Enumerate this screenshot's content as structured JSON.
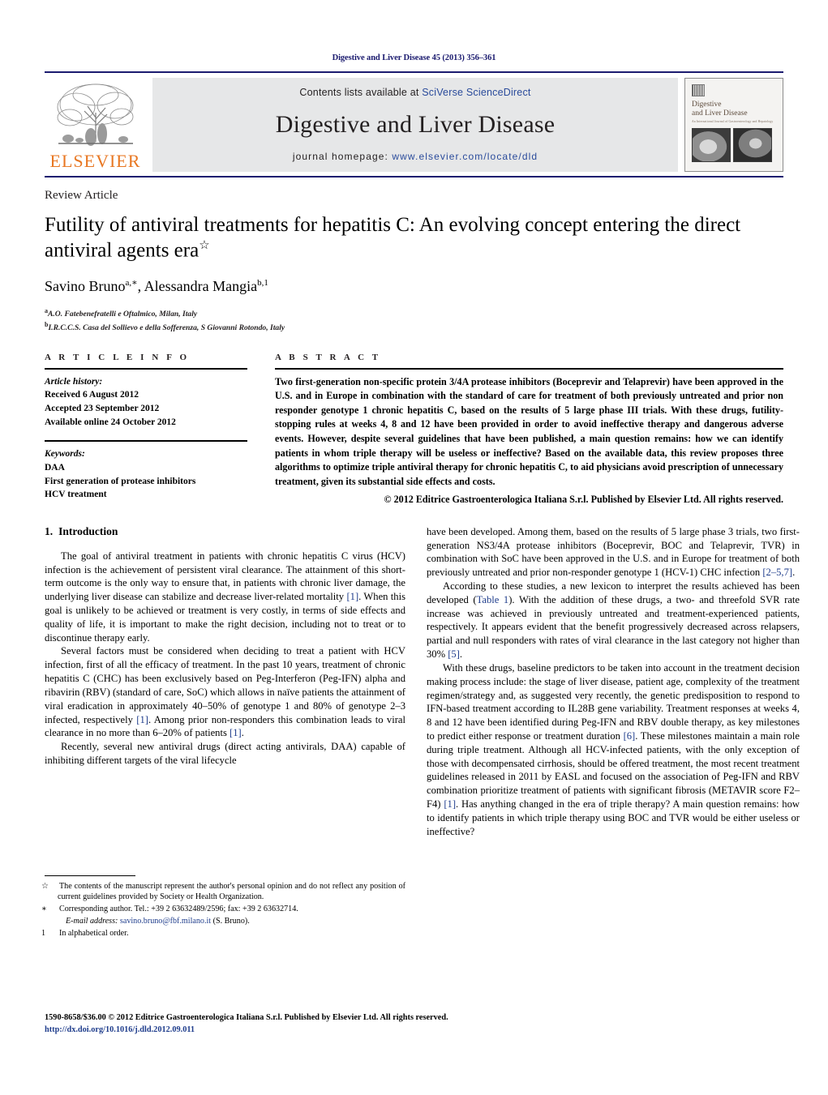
{
  "running_head": "Digestive and Liver Disease 45 (2013) 356–361",
  "masthead": {
    "publisher_name": "ELSEVIER",
    "contents_prefix": "Contents lists available at ",
    "contents_link": "SciVerse ScienceDirect",
    "journal_title": "Digestive and Liver Disease",
    "homepage_label": "journal homepage: ",
    "homepage_url": "www.elsevier.com/locate/dld",
    "cover": {
      "title_line1": "Digestive",
      "title_line2": "and Liver Disease",
      "subtitle": "An International Journal of Gastroenterology and Hepatology"
    }
  },
  "article": {
    "type": "Review Article",
    "title": "Futility of antiviral treatments for hepatitis C: An evolving concept entering the direct antiviral agents era",
    "title_marker": "☆",
    "authors_html": "Savino Bruno<sup>a,∗</sup>, Alessandra Mangia<sup>b,1</sup>",
    "affiliations": [
      {
        "marker": "a",
        "text": "A.O. Fatebenefratelli e Oftalmico, Milan, Italy"
      },
      {
        "marker": "b",
        "text": "I.R.C.C.S. Casa del Sollievo e della Sofferenza, S Giovanni Rotondo, Italy"
      }
    ]
  },
  "info": {
    "heading": "A R T I C L E   I N F O",
    "history_label": "Article history:",
    "history": [
      "Received 6 August 2012",
      "Accepted 23 September 2012",
      "Available online 24 October 2012"
    ],
    "keywords_label": "Keywords:",
    "keywords": [
      "DAA",
      "First generation of protease inhibitors",
      "HCV treatment"
    ]
  },
  "abstract": {
    "heading": "A B S T R A C T",
    "text": "Two first-generation non-specific protein 3/4A protease inhibitors (Boceprevir and Telaprevir) have been approved in the U.S. and in Europe in combination with the standard of care for treatment of both previously untreated and prior non responder genotype 1 chronic hepatitis C, based on the results of 5 large phase III trials. With these drugs, futility-stopping rules at weeks 4, 8 and 12 have been provided in order to avoid ineffective therapy and dangerous adverse events. However, despite several guidelines that have been published, a main question remains: how we can identify patients in whom triple therapy will be useless or ineffective? Based on the available data, this review proposes three algorithms to optimize triple antiviral therapy for chronic hepatitis C, to aid physicians avoid prescription of unnecessary treatment, given its substantial side effects and costs.",
    "copyright": "© 2012 Editrice Gastroenterologica Italiana S.r.l. Published by Elsevier Ltd. All rights reserved."
  },
  "body": {
    "section_number": "1.",
    "section_title": "Introduction",
    "left_paragraphs": [
      "The goal of antiviral treatment in patients with chronic hepatitis C virus (HCV) infection is the achievement of persistent viral clearance. The attainment of this short-term outcome is the only way to ensure that, in patients with chronic liver damage, the underlying liver disease can stabilize and decrease liver-related mortality [1]. When this goal is unlikely to be achieved or treatment is very costly, in terms of side effects and quality of life, it is important to make the right decision, including not to treat or to discontinue therapy early.",
      "Several factors must be considered when deciding to treat a patient with HCV infection, first of all the efficacy of treatment. In the past 10 years, treatment of chronic hepatitis C (CHC) has been exclusively based on Peg-Interferon (Peg-IFN) alpha and ribavirin (RBV) (standard of care, SoC) which allows in naïve patients the attainment of viral eradication in approximately 40–50% of genotype 1 and 80% of genotype 2–3 infected, respectively [1]. Among prior non-responders this combination leads to viral clearance in no more than 6–20% of patients [1].",
      "Recently, several new antiviral drugs (direct acting antivirals, DAA) capable of inhibiting different targets of the viral lifecycle"
    ],
    "right_paragraphs": [
      "have been developed. Among them, based on the results of 5 large phase 3 trials, two first-generation NS3/4A protease inhibitors (Boceprevir, BOC and Telaprevir, TVR) in combination with SoC have been approved in the U.S. and in Europe for treatment of both previously untreated and prior non-responder genotype 1 (HCV-1) CHC infection [2–5,7].",
      "According to these studies, a new lexicon to interpret the results achieved has been developed (Table 1). With the addition of these drugs, a two- and threefold SVR rate increase was achieved in previously untreated and treatment-experienced patients, respectively. It appears evident that the benefit progressively decreased across relapsers, partial and null responders with rates of viral clearance in the last category not higher than 30% [5].",
      "With these drugs, baseline predictors to be taken into account in the treatment decision making process include: the stage of liver disease, patient age, complexity of the treatment regimen/strategy and, as suggested very recently, the genetic predisposition to respond to IFN-based treatment according to IL28B gene variability. Treatment responses at weeks 4, 8 and 12 have been identified during Peg-IFN and RBV double therapy, as key milestones to predict either response or treatment duration [6]. These milestones maintain a main role during triple treatment. Although all HCV-infected patients, with the only exception of those with decompensated cirrhosis, should be offered treatment, the most recent treatment guidelines released in 2011 by EASL and focused on the association of Peg-IFN and RBV combination prioritize treatment of patients with significant fibrosis (METAVIR score F2–F4) [1]. Has anything changed in the era of triple therapy? A main question remains: how to identify patients in which triple therapy using BOC and TVR would be either useless or ineffective?"
    ]
  },
  "footnotes": [
    {
      "mark": "☆",
      "text": "The contents of the manuscript represent the author's personal opinion and do not reflect any position of current guidelines provided by Society or Health Organization."
    },
    {
      "mark": "∗",
      "text": "Corresponding author. Tel.: +39 2 63632489/2596; fax: +39 2 63632714."
    },
    {
      "mark": "",
      "email_label": "E-mail address:",
      "email": "savino.bruno@fbf.milano.it",
      "email_suffix": " (S. Bruno)."
    },
    {
      "mark": "1",
      "text": "In alphabetical order."
    }
  ],
  "page_footer": {
    "line1": "1590-8658/$36.00 © 2012 Editrice Gastroenterologica Italiana S.r.l. Published by Elsevier Ltd. All rights reserved.",
    "doi": "http://dx.doi.org/10.1016/j.dld.2012.09.011"
  },
  "colors": {
    "header_navy": "#1b1b6f",
    "link_blue": "#1f3d8c",
    "elsevier_orange": "#e87722",
    "band_gray": "#e6e7e8"
  }
}
